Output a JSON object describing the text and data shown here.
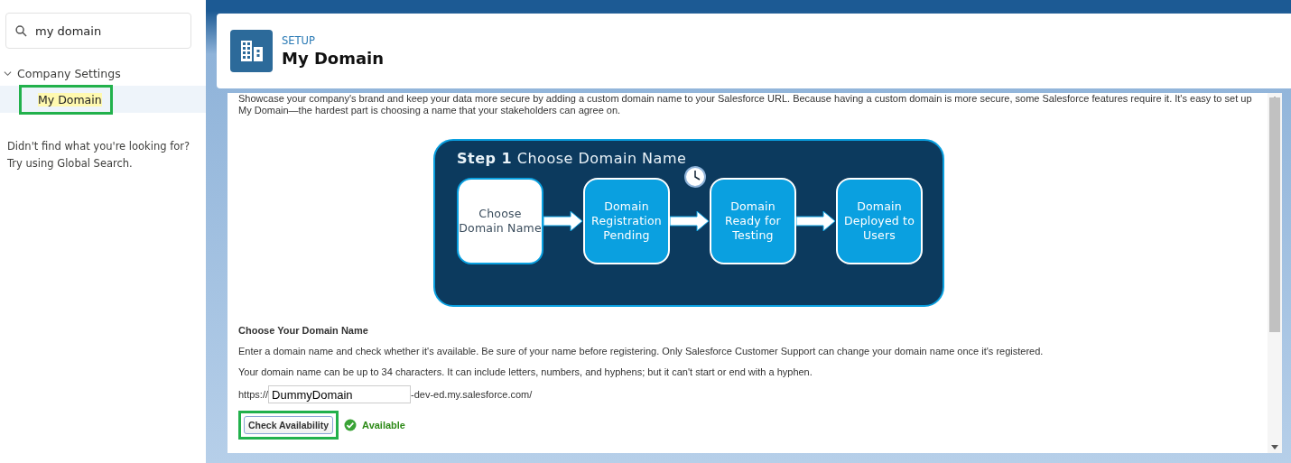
{
  "sidebar": {
    "search": {
      "value": "my domain"
    },
    "tree": [
      {
        "label": "Company Settings",
        "expanded": true,
        "children": [
          {
            "label": "My Domain",
            "selected": true,
            "highlighted": true
          }
        ]
      }
    ],
    "help": [
      "Didn't find what you're looking for?",
      "Try using Global Search."
    ]
  },
  "header": {
    "eyebrow": "SETUP",
    "title": "My Domain"
  },
  "intro": "Showcase your company's brand and keep your data more secure by adding a custom domain name to your Salesforce URL. Because having a custom domain is more secure, some Salesforce features require it. It's easy to set up My Domain—the hardest part is choosing a name that your stakeholders can agree on.",
  "diagram": {
    "step": "Step 1",
    "title": "Choose Domain Name",
    "stages": [
      {
        "label": "Choose Domain Name",
        "current": true,
        "clock_after": false
      },
      {
        "label": "Domain Registration Pending",
        "current": false,
        "clock_after": true
      },
      {
        "label": "Domain Ready for Testing",
        "current": false,
        "clock_after": false
      },
      {
        "label": "Domain Deployed to Users",
        "current": false,
        "clock_after": false
      }
    ]
  },
  "form": {
    "heading": "Choose Your Domain Name",
    "paragraphs": [
      "Enter a domain name and check whether it's available. Be sure of your name before registering. Only Salesforce Customer Support can change your domain name once it's registered.",
      "Your domain name can be up to 34 characters. It can include letters, numbers, and hyphens; but it can't start or end with a hyphen."
    ],
    "prefix": "https://",
    "value": "DummyDomain",
    "suffix": "-dev-ed.my.salesforce.com/",
    "button": {
      "label": "Check Availability",
      "highlighted": true
    },
    "status": {
      "label": "Available",
      "ok": true
    }
  }
}
